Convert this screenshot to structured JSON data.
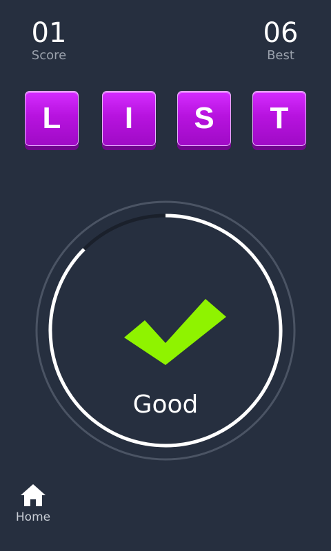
{
  "score": {
    "value": "01",
    "label": "Score"
  },
  "best": {
    "value": "06",
    "label": "Best"
  },
  "tiles": [
    "L",
    "I",
    "S",
    "T"
  ],
  "timer": {
    "remaining_fraction": 0.875
  },
  "result": {
    "label": "Good",
    "icon": "checkmark-icon"
  },
  "nav": {
    "home_label": "Home",
    "home_icon": "home-icon"
  },
  "colors": {
    "background": "#262f3f",
    "tile": "#b713df",
    "check": "#8ff300",
    "ring": "#ffffff",
    "track": "#1a202b"
  }
}
